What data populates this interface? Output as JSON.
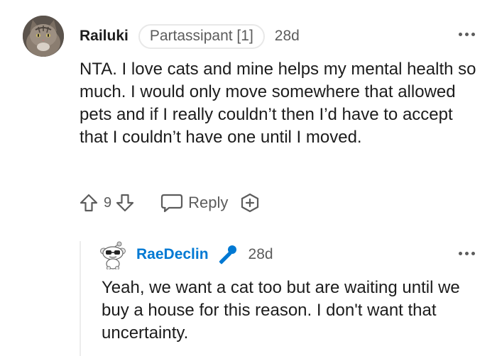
{
  "comment": {
    "author": "Railuki",
    "flair": "Partassipant [1]",
    "time": "28d",
    "body": "NTA. I love cats and mine helps my mental health so much. I would only move somewhere that allowed pets and if I really couldn’t then I’d have to accept that I couldn’t have one until I moved.",
    "votes": "9",
    "reply_label": "Reply",
    "avatar_icon": "cat-photo",
    "colors": {
      "text": "#1c1c1c",
      "muted": "#5c5c5c"
    }
  },
  "reply": {
    "author": "RaeDeclin",
    "time": "28d",
    "body": "Yeah, we want a cat too but are waiting until we buy a house for this reason. I don't want that uncertainty.",
    "author_icon": "microphone-icon",
    "avatar_icon": "snoo-avatar",
    "colors": {
      "author": "#0079d3"
    }
  }
}
